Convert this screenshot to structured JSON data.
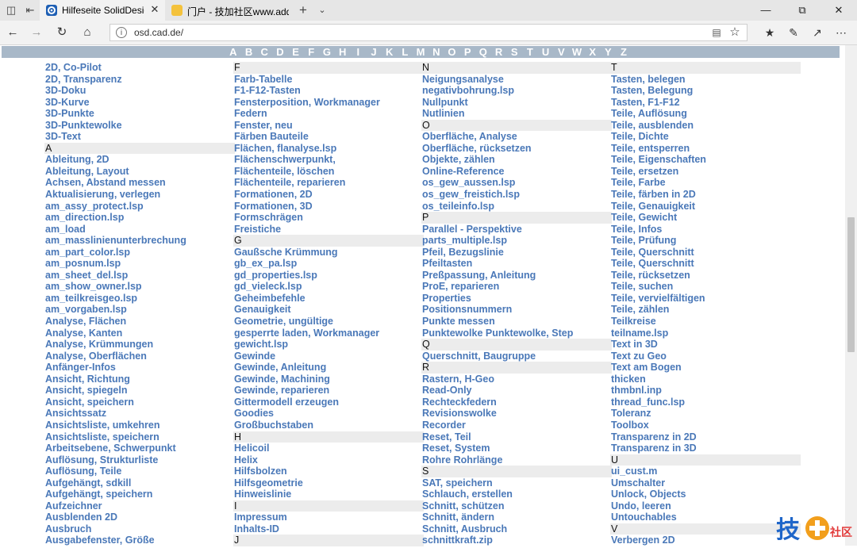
{
  "browser": {
    "tabs": [
      {
        "title": "Hilfeseite SolidDesigner",
        "active": true
      },
      {
        "title": "门户 - 技加社区www.addski",
        "active": false
      }
    ],
    "url": "osd.cad.de/",
    "colors": {
      "link": "#4a78b8",
      "alpha_bar": "#a8b8c8",
      "section_bg": "#ececec"
    }
  },
  "alphabet": [
    "A",
    "B",
    "C",
    "D",
    "E",
    "F",
    "G",
    "H",
    "I",
    "J",
    "K",
    "L",
    "M",
    "N",
    "O",
    "P",
    "Q",
    "R",
    "S",
    "T",
    "U",
    "V",
    "W",
    "X",
    "Y",
    "Z"
  ],
  "columns": [
    [
      {
        "t": "2D, Co-Pilot",
        "h": false
      },
      {
        "t": "2D, Transparenz",
        "h": false
      },
      {
        "t": "3D-Doku",
        "h": false
      },
      {
        "t": "3D-Kurve",
        "h": false
      },
      {
        "t": "3D-Punkte",
        "h": false
      },
      {
        "t": "3D-Punktewolke",
        "h": false
      },
      {
        "t": "3D-Text",
        "h": false
      },
      {
        "t": "A",
        "h": true
      },
      {
        "t": "Ableitung, 2D",
        "h": false
      },
      {
        "t": "Ableitung, Layout",
        "h": false
      },
      {
        "t": "Achsen, Abstand messen",
        "h": false
      },
      {
        "t": "Aktualisierung, verlegen",
        "h": false
      },
      {
        "t": "am_assy_protect.lsp",
        "h": false
      },
      {
        "t": "am_direction.lsp",
        "h": false
      },
      {
        "t": "am_load",
        "h": false
      },
      {
        "t": "am_masslinienunterbrechung",
        "h": false
      },
      {
        "t": "am_part_color.lsp",
        "h": false
      },
      {
        "t": "am_posnum.lsp",
        "h": false
      },
      {
        "t": "am_sheet_del.lsp",
        "h": false
      },
      {
        "t": "am_show_owner.lsp",
        "h": false
      },
      {
        "t": "am_teilkreisgeo.lsp",
        "h": false
      },
      {
        "t": "am_vorgaben.lsp",
        "h": false
      },
      {
        "t": "Analyse, Flächen",
        "h": false
      },
      {
        "t": "Analyse, Kanten",
        "h": false
      },
      {
        "t": "Analyse, Krümmungen",
        "h": false
      },
      {
        "t": "Analyse, Oberflächen",
        "h": false
      },
      {
        "t": "Anfänger-Infos",
        "h": false
      },
      {
        "t": "Ansicht, Richtung",
        "h": false
      },
      {
        "t": "Ansicht, spiegeln",
        "h": false
      },
      {
        "t": "Ansicht, speichern",
        "h": false
      },
      {
        "t": "Ansichtssatz",
        "h": false
      },
      {
        "t": "Ansichtsliste, umkehren",
        "h": false
      },
      {
        "t": "Ansichtsliste, speichern",
        "h": false
      },
      {
        "t": "Arbeitsebene, Schwerpunkt",
        "h": false
      },
      {
        "t": "Auflösung, Strukturliste",
        "h": false
      },
      {
        "t": "Auflösung, Teile",
        "h": false
      },
      {
        "t": "Aufgehängt, sdkill",
        "h": false
      },
      {
        "t": "Aufgehängt, speichern",
        "h": false
      },
      {
        "t": "Aufzeichner",
        "h": false
      },
      {
        "t": "Ausblenden 2D",
        "h": false
      },
      {
        "t": "Ausbruch",
        "h": false
      },
      {
        "t": "Ausgabefenster, Größe",
        "h": false
      }
    ],
    [
      {
        "t": "F",
        "h": true
      },
      {
        "t": "Farb-Tabelle",
        "h": false
      },
      {
        "t": "F1-F12-Tasten",
        "h": false
      },
      {
        "t": "Fensterposition, Workmanager",
        "h": false
      },
      {
        "t": "Federn",
        "h": false
      },
      {
        "t": "Fenster, neu",
        "h": false
      },
      {
        "t": "Färben Bauteile",
        "h": false
      },
      {
        "t": "Flächen, flanalyse.lsp",
        "h": false
      },
      {
        "t": "Flächenschwerpunkt,",
        "h": false
      },
      {
        "t": "Flächenteile, löschen",
        "h": false
      },
      {
        "t": "Flächenteile, reparieren",
        "h": false
      },
      {
        "t": "Formationen, 2D",
        "h": false
      },
      {
        "t": "Formationen, 3D",
        "h": false
      },
      {
        "t": "Formschrägen",
        "h": false
      },
      {
        "t": "Freistiche",
        "h": false
      },
      {
        "t": "G",
        "h": true
      },
      {
        "t": "Gaußsche Krümmung",
        "h": false
      },
      {
        "t": "gb_ex_pa.lsp",
        "h": false
      },
      {
        "t": "gd_properties.lsp",
        "h": false
      },
      {
        "t": "gd_vieleck.lsp",
        "h": false
      },
      {
        "t": "Geheimbefehle",
        "h": false
      },
      {
        "t": "Genauigkeit",
        "h": false
      },
      {
        "t": "Geometrie, ungültige",
        "h": false
      },
      {
        "t": "gesperrte laden, Workmanager",
        "h": false
      },
      {
        "t": "gewicht.lsp",
        "h": false
      },
      {
        "t": "Gewinde",
        "h": false
      },
      {
        "t": "Gewinde, Anleitung",
        "h": false
      },
      {
        "t": "Gewinde, Machining",
        "h": false
      },
      {
        "t": "Gewinde, reparieren",
        "h": false
      },
      {
        "t": "Gittermodell erzeugen",
        "h": false
      },
      {
        "t": "Goodies",
        "h": false
      },
      {
        "t": "Großbuchstaben",
        "h": false
      },
      {
        "t": "H",
        "h": true
      },
      {
        "t": "Helicoil",
        "h": false
      },
      {
        "t": "Helix",
        "h": false
      },
      {
        "t": "Hilfsbolzen",
        "h": false
      },
      {
        "t": "Hilfsgeometrie",
        "h": false
      },
      {
        "t": "Hinweislinie",
        "h": false
      },
      {
        "t": "I",
        "h": true
      },
      {
        "t": "Impressum",
        "h": false
      },
      {
        "t": "Inhalts-ID",
        "h": false
      },
      {
        "t": "J",
        "h": true
      }
    ],
    [
      {
        "t": "N",
        "h": true
      },
      {
        "t": "Neigungsanalyse",
        "h": false
      },
      {
        "t": "negativbohrung.lsp",
        "h": false
      },
      {
        "t": "Nullpunkt",
        "h": false
      },
      {
        "t": "Nutlinien",
        "h": false
      },
      {
        "t": "O",
        "h": true
      },
      {
        "t": "Oberfläche, Analyse",
        "h": false
      },
      {
        "t": "Oberfläche, rücksetzen",
        "h": false
      },
      {
        "t": "Objekte, zählen",
        "h": false
      },
      {
        "t": "Online-Reference",
        "h": false
      },
      {
        "t": "os_gew_aussen.lsp",
        "h": false
      },
      {
        "t": "os_gew_freistich.lsp",
        "h": false
      },
      {
        "t": "os_teileinfo.lsp",
        "h": false
      },
      {
        "t": "P",
        "h": true
      },
      {
        "t": "Parallel - Perspektive",
        "h": false
      },
      {
        "t": "parts_multiple.lsp",
        "h": false
      },
      {
        "t": "Pfeil, Bezugslinie",
        "h": false
      },
      {
        "t": "Pfeiltasten",
        "h": false
      },
      {
        "t": "Preßpassung, Anleitung",
        "h": false
      },
      {
        "t": "ProE, reparieren",
        "h": false
      },
      {
        "t": "Properties",
        "h": false
      },
      {
        "t": "Positionsnummern",
        "h": false
      },
      {
        "t": "Punkte messen",
        "h": false
      },
      {
        "t": "Punktewolke Punktewolke, Step",
        "h": false
      },
      {
        "t": "Q",
        "h": true
      },
      {
        "t": "Querschnitt, Baugruppe",
        "h": false
      },
      {
        "t": "R",
        "h": true
      },
      {
        "t": "Rastern, H-Geo",
        "h": false
      },
      {
        "t": "Read-Only",
        "h": false
      },
      {
        "t": "Rechteckfedern",
        "h": false
      },
      {
        "t": "Revisionswolke",
        "h": false
      },
      {
        "t": "Recorder",
        "h": false
      },
      {
        "t": "Reset, Teil",
        "h": false
      },
      {
        "t": "Reset, System",
        "h": false
      },
      {
        "t": "Rohre Rohrlänge",
        "h": false
      },
      {
        "t": "S",
        "h": true
      },
      {
        "t": "SAT, speichern",
        "h": false
      },
      {
        "t": "Schlauch, erstellen",
        "h": false
      },
      {
        "t": "Schnitt, schützen",
        "h": false
      },
      {
        "t": "Schnitt, ändern",
        "h": false
      },
      {
        "t": "Schnitt, Ausbruch",
        "h": false
      },
      {
        "t": "schnittkraft.zip",
        "h": false
      }
    ],
    [
      {
        "t": "T",
        "h": true
      },
      {
        "t": "Tasten, belegen",
        "h": false
      },
      {
        "t": "Tasten, Belegung",
        "h": false
      },
      {
        "t": "Tasten, F1-F12",
        "h": false
      },
      {
        "t": "Teile, Auflösung",
        "h": false
      },
      {
        "t": "Teile, ausblenden",
        "h": false
      },
      {
        "t": "Teile, Dichte",
        "h": false
      },
      {
        "t": "Teile, entsperren",
        "h": false
      },
      {
        "t": "Teile, Eigenschaften",
        "h": false
      },
      {
        "t": "Teile, ersetzen",
        "h": false
      },
      {
        "t": "Teile, Farbe",
        "h": false
      },
      {
        "t": "Teile, färben in 2D",
        "h": false
      },
      {
        "t": "Teile, Genauigkeit",
        "h": false
      },
      {
        "t": "Teile, Gewicht",
        "h": false
      },
      {
        "t": "Teile, Infos",
        "h": false
      },
      {
        "t": "Teile, Prüfung",
        "h": false
      },
      {
        "t": "Teile, Querschnitt",
        "h": false
      },
      {
        "t": "Teile, Querschnitt",
        "h": false
      },
      {
        "t": "Teile, rücksetzen",
        "h": false
      },
      {
        "t": "Teile, suchen",
        "h": false
      },
      {
        "t": "Teile, vervielfältigen",
        "h": false
      },
      {
        "t": "Teile, zählen",
        "h": false
      },
      {
        "t": "Teilkreise",
        "h": false
      },
      {
        "t": "teilname.lsp",
        "h": false
      },
      {
        "t": "Text in 3D",
        "h": false
      },
      {
        "t": "Text zu Geo",
        "h": false
      },
      {
        "t": "Text am Bogen",
        "h": false
      },
      {
        "t": "thicken",
        "h": false
      },
      {
        "t": "thmbnl.inp",
        "h": false
      },
      {
        "t": "thread_func.lsp",
        "h": false
      },
      {
        "t": "Toleranz",
        "h": false
      },
      {
        "t": "Toolbox",
        "h": false
      },
      {
        "t": "Transparenz in 2D",
        "h": false
      },
      {
        "t": "Transparenz in 3D",
        "h": false
      },
      {
        "t": "U",
        "h": true
      },
      {
        "t": "ui_cust.m",
        "h": false
      },
      {
        "t": "Umschalter",
        "h": false
      },
      {
        "t": "Unlock, Objects",
        "h": false
      },
      {
        "t": "Undo, leeren",
        "h": false
      },
      {
        "t": "Untouchables",
        "h": false
      },
      {
        "t": "V",
        "h": true
      },
      {
        "t": "Verbergen 2D",
        "h": false
      }
    ]
  ],
  "watermark": {
    "glyph": "技",
    "small_text": "社区"
  }
}
